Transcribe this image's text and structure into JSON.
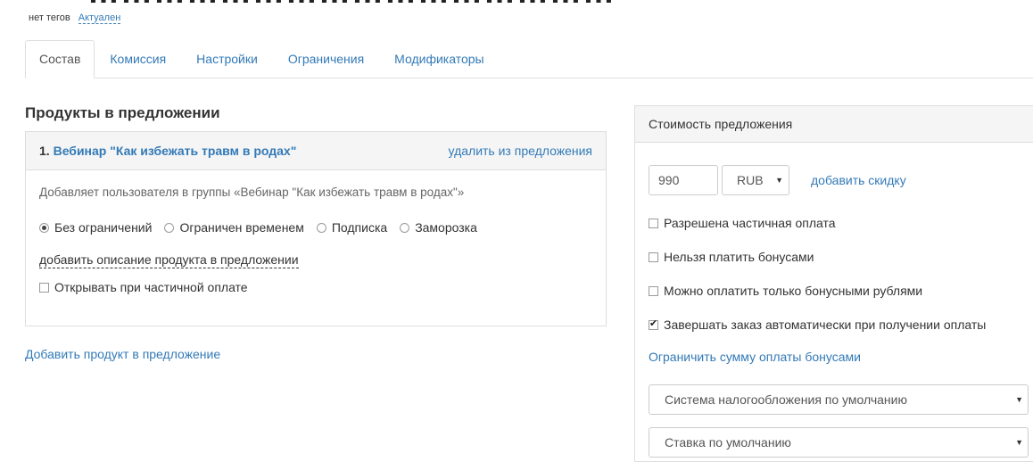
{
  "header": {
    "title": "…………………………………………",
    "tags_text": "нет тегов",
    "status_link": "Актуален"
  },
  "tabs": [
    {
      "label": "Состав",
      "active": true
    },
    {
      "label": "Комиссия",
      "active": false
    },
    {
      "label": "Настройки",
      "active": false
    },
    {
      "label": "Ограничения",
      "active": false
    },
    {
      "label": "Модификаторы",
      "active": false
    }
  ],
  "products": {
    "section_title": "Продукты в предложении",
    "item": {
      "number": "1.",
      "name": "Вебинар \"Как избежать травм в родах\"",
      "remove_label": "удалить из предложения",
      "description": "Добавляет пользователя в группы «Вебинар \"Как избежать травм в родах\"»",
      "access_options": [
        {
          "label": "Без ограничений",
          "selected": true
        },
        {
          "label": "Ограничен временем",
          "selected": false
        },
        {
          "label": "Подписка",
          "selected": false
        },
        {
          "label": "Заморозка",
          "selected": false
        }
      ],
      "add_description_label": "добавить описание продукта в предложении",
      "open_on_partial_label": "Открывать при частичной оплате",
      "open_on_partial_checked": false
    },
    "add_product_label": "Добавить продукт в предложение"
  },
  "pricing": {
    "title": "Стоимость предложения",
    "price_value": "990",
    "currency": "RUB",
    "add_discount_label": "добавить скидку",
    "options": [
      {
        "label": "Разрешена частичная оплата",
        "checked": false
      },
      {
        "label": "Нельзя платить бонусами",
        "checked": false
      },
      {
        "label": "Можно оплатить только бонусными рублями",
        "checked": false
      },
      {
        "label": "Завершать заказ автоматически при получении оплаты",
        "checked": true
      }
    ],
    "limit_bonus_label": "Ограничить сумму оплаты бонусами",
    "tax_system": "Система налогообложения по умолчанию",
    "vat_rate": "Ставка по умолчанию"
  },
  "colors": {
    "link": "#337ab7",
    "border": "#dddddd",
    "panel_header_bg": "#f5f5f5"
  }
}
